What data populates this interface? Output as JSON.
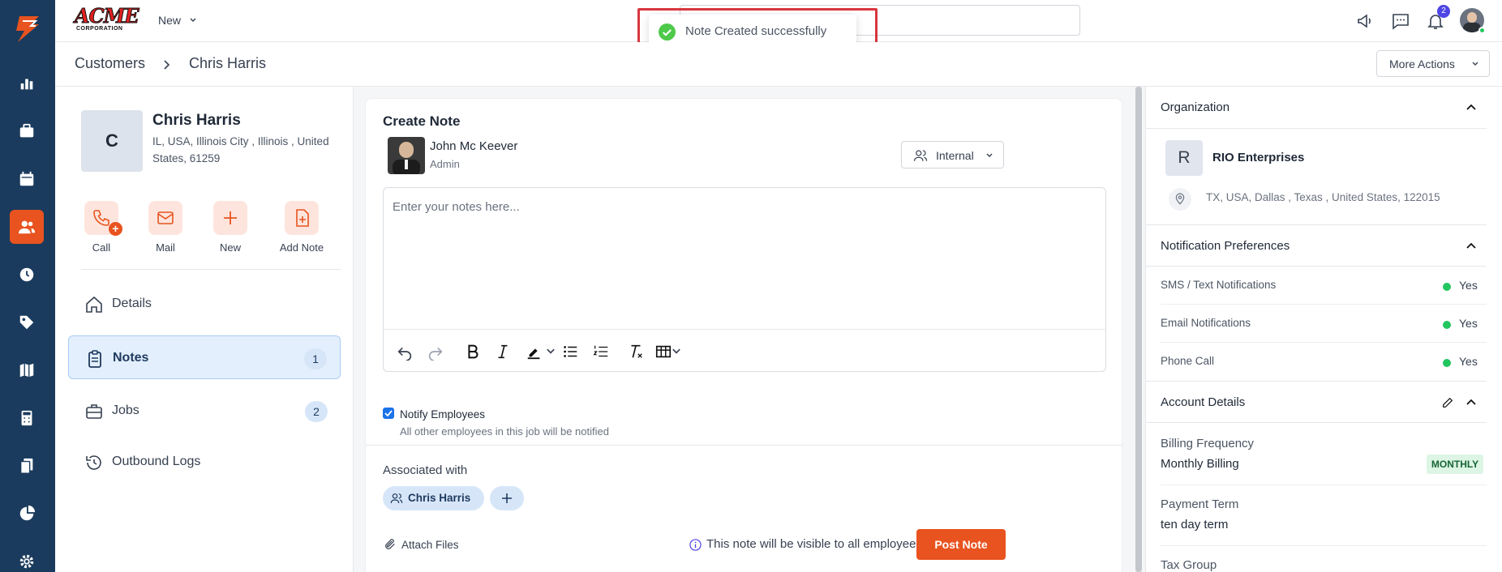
{
  "topbar": {
    "logo_text": "ACME",
    "logo_subtext": "CORPORATION",
    "new_label": "New",
    "notification_count": "2"
  },
  "toast": {
    "message": "Note Created successfully"
  },
  "breadcrumb": {
    "parent": "Customers",
    "current": "Chris Harris"
  },
  "more_actions": "More Actions",
  "customer": {
    "initial": "C",
    "name": "Chris Harris",
    "address_line1": "IL, USA, Illinois City , Illinois , United",
    "address_line2": "States, 61259"
  },
  "actions": [
    {
      "label": "Call",
      "icon": "phone-plus-icon"
    },
    {
      "label": "Mail",
      "icon": "mail-icon"
    },
    {
      "label": "New",
      "icon": "plus-icon"
    },
    {
      "label": "Add Note",
      "icon": "add-note-icon"
    }
  ],
  "menu": [
    {
      "label": "Details",
      "icon": "home-icon",
      "count": ""
    },
    {
      "label": "Notes",
      "icon": "clipboard-icon",
      "count": "1"
    },
    {
      "label": "Jobs",
      "icon": "briefcase-icon",
      "count": "2"
    },
    {
      "label": "Outbound Logs",
      "icon": "history-icon",
      "count": ""
    }
  ],
  "note": {
    "title": "Create Note",
    "author_name": "John Mc Keever",
    "author_role": "Admin",
    "visibility": "Internal",
    "placeholder": "Enter your notes here...",
    "notify_label": "Notify Employees",
    "notify_checked": true,
    "notify_sub": "All other employees in this job will be notified",
    "associated_title": "Associated with",
    "associated_chip": "Chris Harris",
    "attach_label": "Attach Files",
    "visibility_info": "This note will be visible to all employees",
    "post_label": "Post Note"
  },
  "organization": {
    "section_title": "Organization",
    "initial": "R",
    "name": "RIO Enterprises",
    "address": "TX, USA, Dallas , Texas , United States, 122015"
  },
  "notification_prefs": {
    "section_title": "Notification Preferences",
    "rows": [
      {
        "label": "SMS / Text Notifications",
        "value": "Yes"
      },
      {
        "label": "Email Notifications",
        "value": "Yes"
      },
      {
        "label": "Phone Call",
        "value": "Yes"
      }
    ]
  },
  "account_details": {
    "section_title": "Account Details",
    "billing_label": "Billing Frequency",
    "billing_value": "Monthly Billing",
    "billing_badge": "MONTHLY",
    "payment_label": "Payment Term",
    "payment_value": "ten day term",
    "tax_label": "Tax Group"
  },
  "colors": {
    "accent": "#e8531f",
    "nav_bg": "#1a3b5d",
    "success": "#22c55e",
    "highlight": "#d9363e"
  }
}
